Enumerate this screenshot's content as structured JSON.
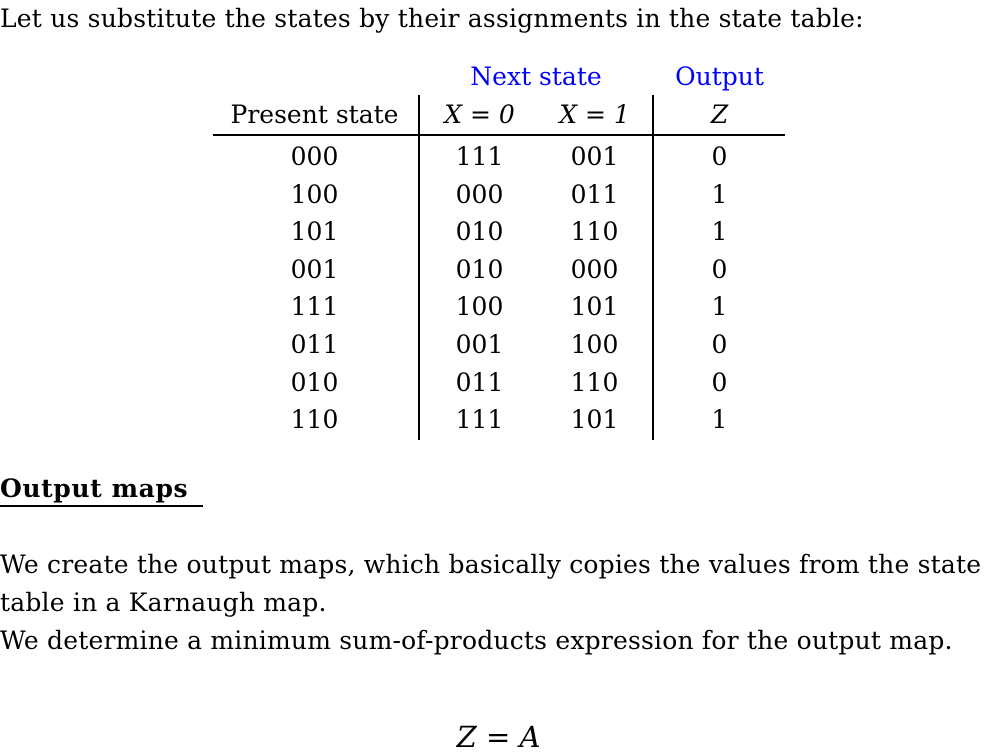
{
  "document": {
    "intro_text": "Let us substitute the states by their assignments in the state table:",
    "section_heading": "Output maps",
    "paragraph_line_1": "We create the output maps, which basically copies the values from the state",
    "paragraph_line_2": "table in a Karnaugh map.",
    "paragraph_line_3": "We determine a minimum sum-of-products expression for the output map.",
    "equation": "Z = A"
  },
  "colors": {
    "text": "#000000",
    "group_header": "#0000ff",
    "rule": "#000000",
    "background": "#ffffff"
  },
  "state_table": {
    "group_headers": {
      "next_state": "Next state",
      "output": "Output"
    },
    "column_headers": {
      "present_state": "Present state",
      "x_eq_0": "X = 0",
      "x_eq_1": "X = 1",
      "z": "Z"
    },
    "rows": [
      {
        "present": "000",
        "next_x0": "111",
        "next_x1": "001",
        "z": "0"
      },
      {
        "present": "100",
        "next_x0": "000",
        "next_x1": "011",
        "z": "1"
      },
      {
        "present": "101",
        "next_x0": "010",
        "next_x1": "110",
        "z": "1"
      },
      {
        "present": "001",
        "next_x0": "010",
        "next_x1": "000",
        "z": "0"
      },
      {
        "present": "111",
        "next_x0": "100",
        "next_x1": "101",
        "z": "1"
      },
      {
        "present": "011",
        "next_x0": "001",
        "next_x1": "100",
        "z": "0"
      },
      {
        "present": "010",
        "next_x0": "011",
        "next_x1": "110",
        "z": "0"
      },
      {
        "present": "110",
        "next_x0": "111",
        "next_x1": "101",
        "z": "1"
      }
    ]
  }
}
